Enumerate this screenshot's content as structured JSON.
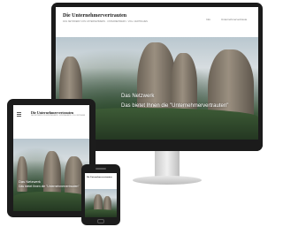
{
  "site": {
    "title": "Die Unternehmervertrauten",
    "tagline": "DAS NETZWERK VON UNTERNEHMERN · UNTERNEHMERN - VOLL VERTRAUEN"
  },
  "nav": [
    "Info",
    "Unternehmervertraute"
  ],
  "hero": {
    "line1": "Das Netzwerk",
    "line2": "Das bietet Ihnen die \"Unternehmervertrauten\""
  },
  "tablet": {
    "menu_icon": "hamburger-menu-icon",
    "hero_line1": "Das Netzwerk",
    "hero_line2": "Das bietet Ihnen die \"Unternehmervertrauten\""
  },
  "colors": {
    "device": "#1b1b1b",
    "stand": "#d9d9d9"
  }
}
